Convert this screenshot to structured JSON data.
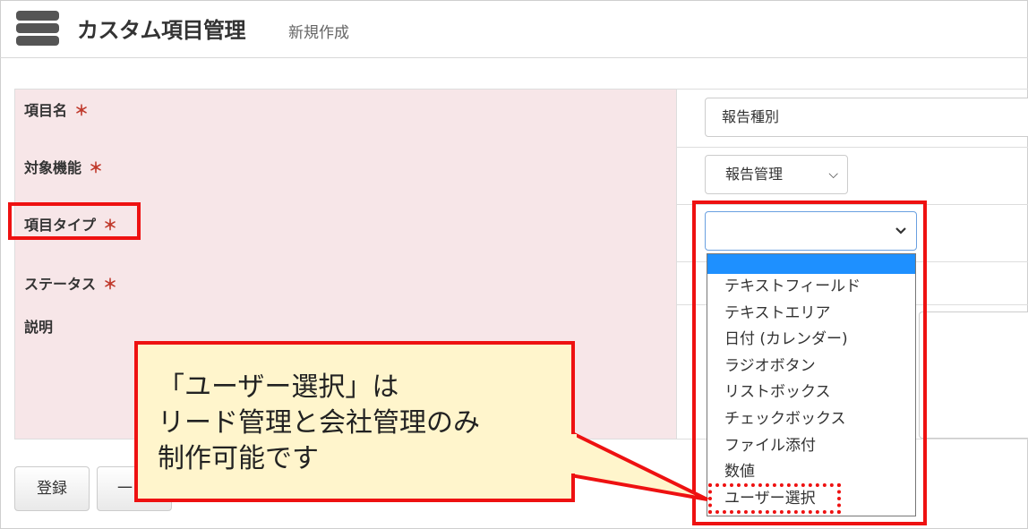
{
  "header": {
    "title": "カスタム項目管理",
    "subtitle": "新規作成",
    "icon": "database-icon"
  },
  "form": {
    "item_name_label": "項目名",
    "item_name_value": "報告種別",
    "target_function_label": "対象機能",
    "target_function_value": "報告管理",
    "item_type_label": "項目タイプ",
    "status_label": "ステータス",
    "description_label": "説明",
    "required_mark": "＊"
  },
  "dropdown": {
    "options": [
      "テキストフィールド",
      "テキストエリア",
      "日付 (カレンダー)",
      "ラジオボタン",
      "リストボックス",
      "チェックボックス",
      "ファイル添付",
      "数値",
      "ユーザー選択"
    ]
  },
  "buttons": {
    "register": "登録",
    "second_partial": "一"
  },
  "callout": {
    "text": "「ユーザー選択」は\nリード管理と会社管理のみ\n制作可能です"
  },
  "colors": {
    "highlight_red": "#ee1111",
    "label_bg": "#f7e6e8",
    "callout_bg": "#fff5cc",
    "selected_option": "#1e90ff"
  }
}
